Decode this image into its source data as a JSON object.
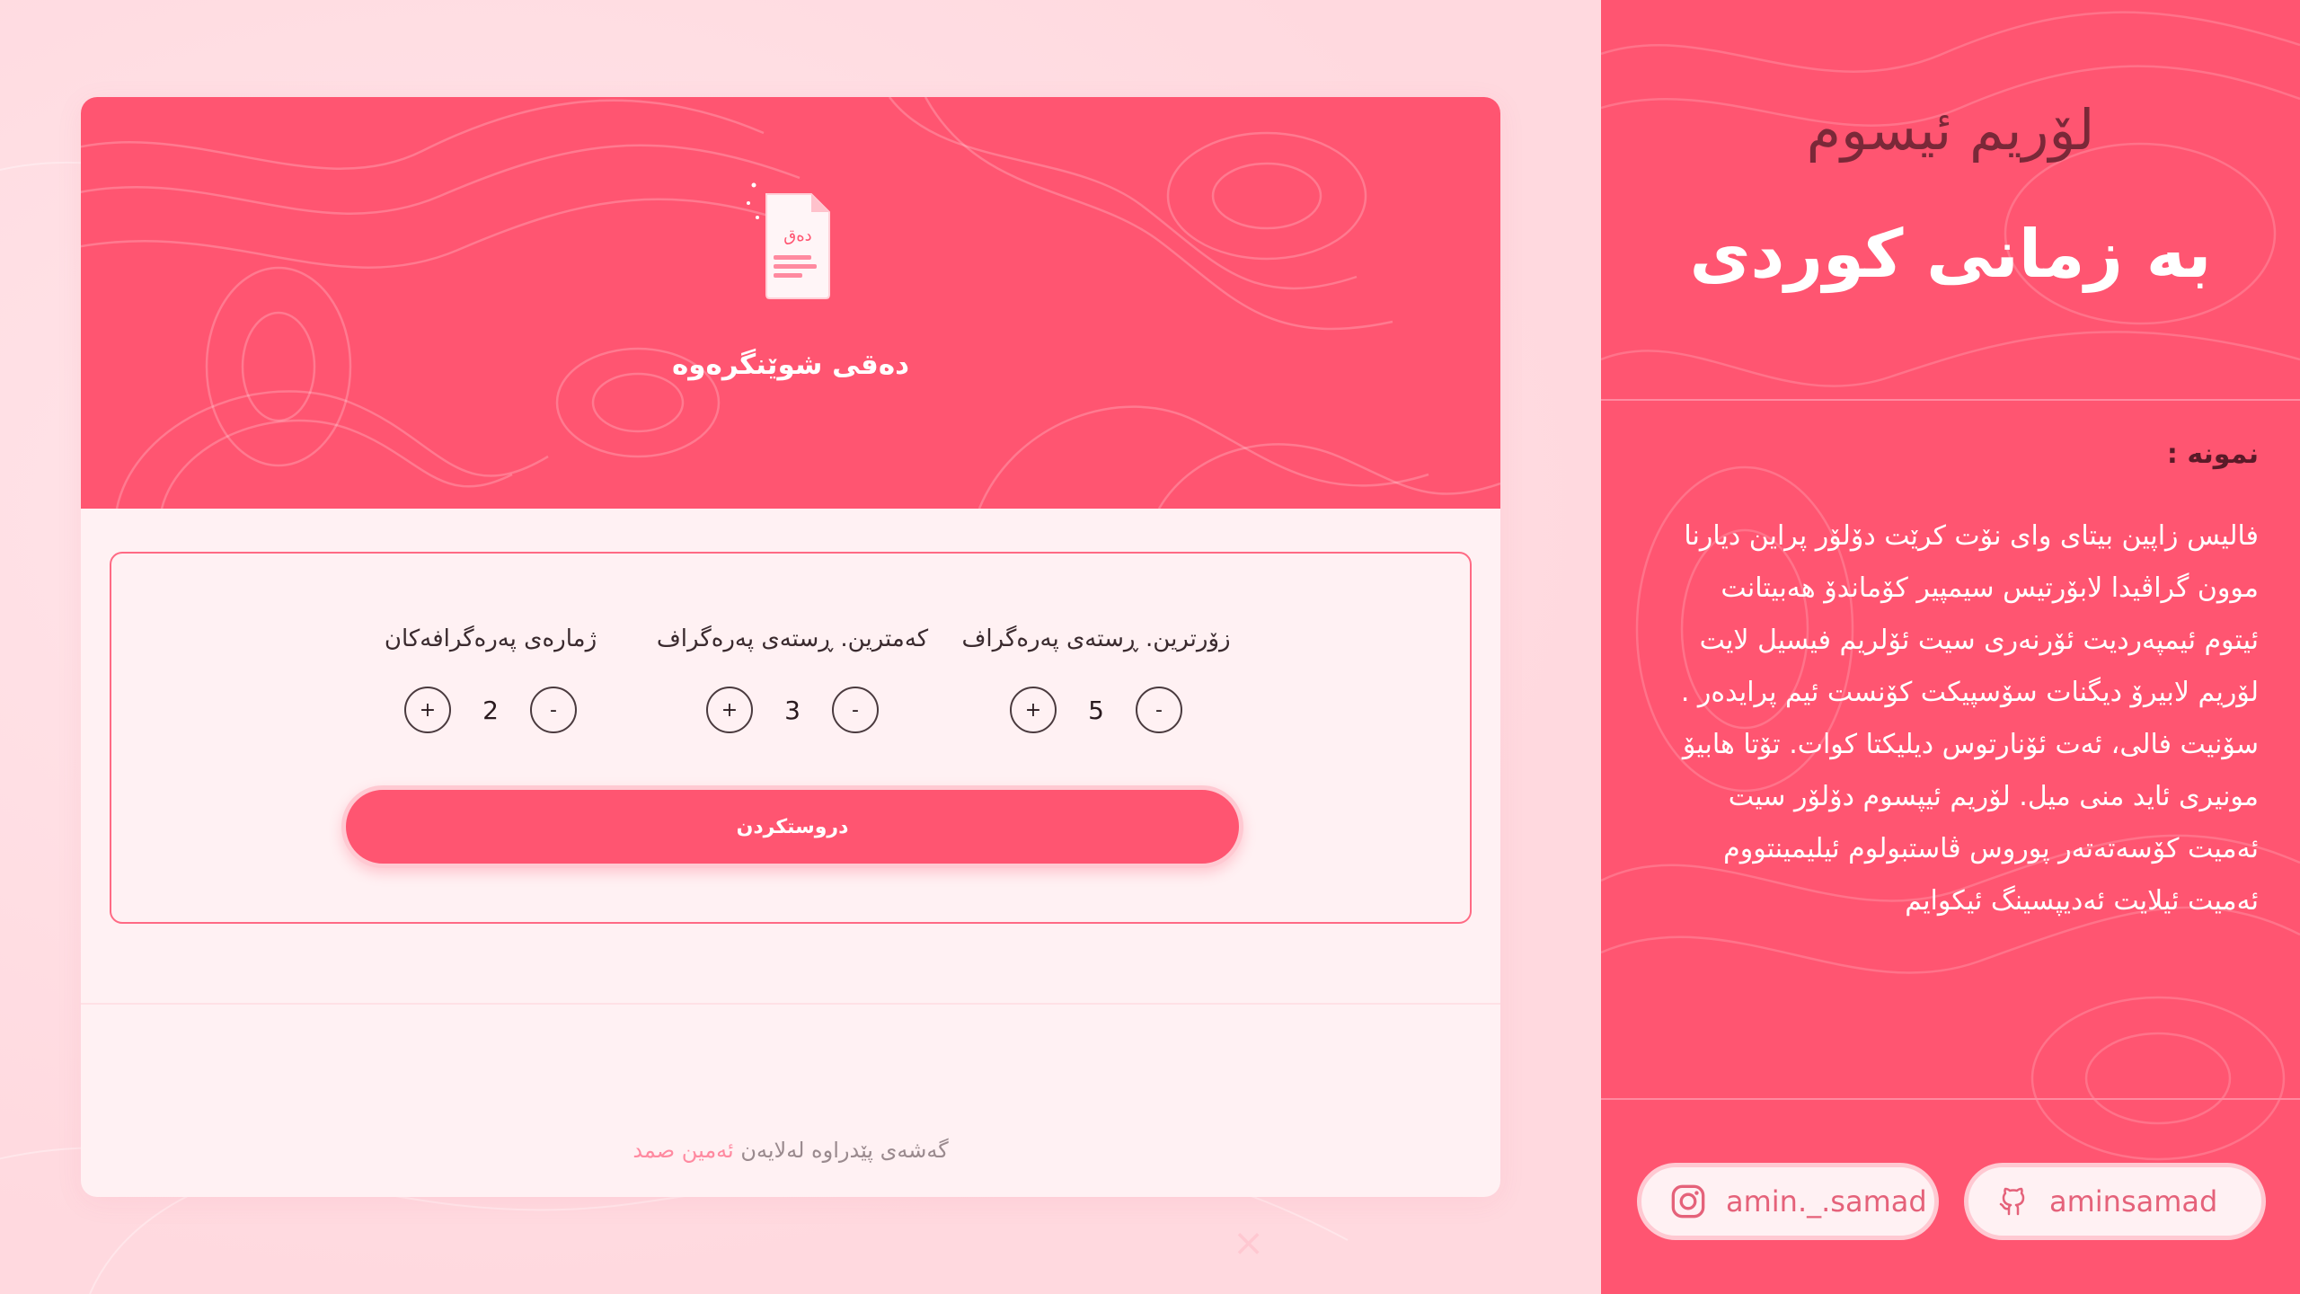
{
  "card": {
    "hero_title": "دەقی شوێنگرەوە",
    "doc_icon_text": "دەق",
    "controls": [
      {
        "label": "ژمارەی پەرەگرافەکان",
        "value": "2",
        "minus": "-",
        "plus": "+"
      },
      {
        "label": "کەمترین. ڕستەی پەرەگراف",
        "value": "3",
        "minus": "-",
        "plus": "+"
      },
      {
        "label": "زۆرترین. ڕستەی پەرەگراف",
        "value": "5",
        "minus": "-",
        "plus": "+"
      }
    ],
    "generate_label": "دروستکردن",
    "credit_prefix": "گەشەی پێدراوە لەلایەن",
    "credit_author": "ئەمین صمد",
    "close_label": "×"
  },
  "sidebar": {
    "title1": "لۆریم ئیسوم",
    "title2": "بە زمانی کوردی",
    "example_label": "نمونە :",
    "paragraph_lines": [
      "فالیس زاپین بیتای وای نۆت کرێت دۆلۆر پراین دیارنا",
      "موون گراڤیدا لابۆرتیس سیمپیر کۆماندۆ هەبیتانت",
      "ئیتوم ئیمپەردیت ئۆرنەری سیت ئۆلریم فیسیل لایت",
      "لۆریم لابیرۆ دیگنات سۆسپیکت کۆنست ئیم پرایدەر .",
      "سۆنیت فالی، ئەت ئۆنارتوس دیلیکتا کوات. تۆتا هابیۆ",
      "مونیری ئاید منی میل. لۆریم ئیپسوم دۆلۆر سیت",
      "ئەمیت کۆسەتەتەر پوروس ڤاستبولوم ئیلیمینتووم",
      "ئەمیت ئیلایت ئەدیپسینگ ئیکوایم"
    ],
    "instagram_handle": "amin._.samad",
    "github_handle": "aminsamad"
  },
  "colors": {
    "accent": "#ff5571",
    "background": "#ffd9df",
    "card": "#fff1f3"
  }
}
